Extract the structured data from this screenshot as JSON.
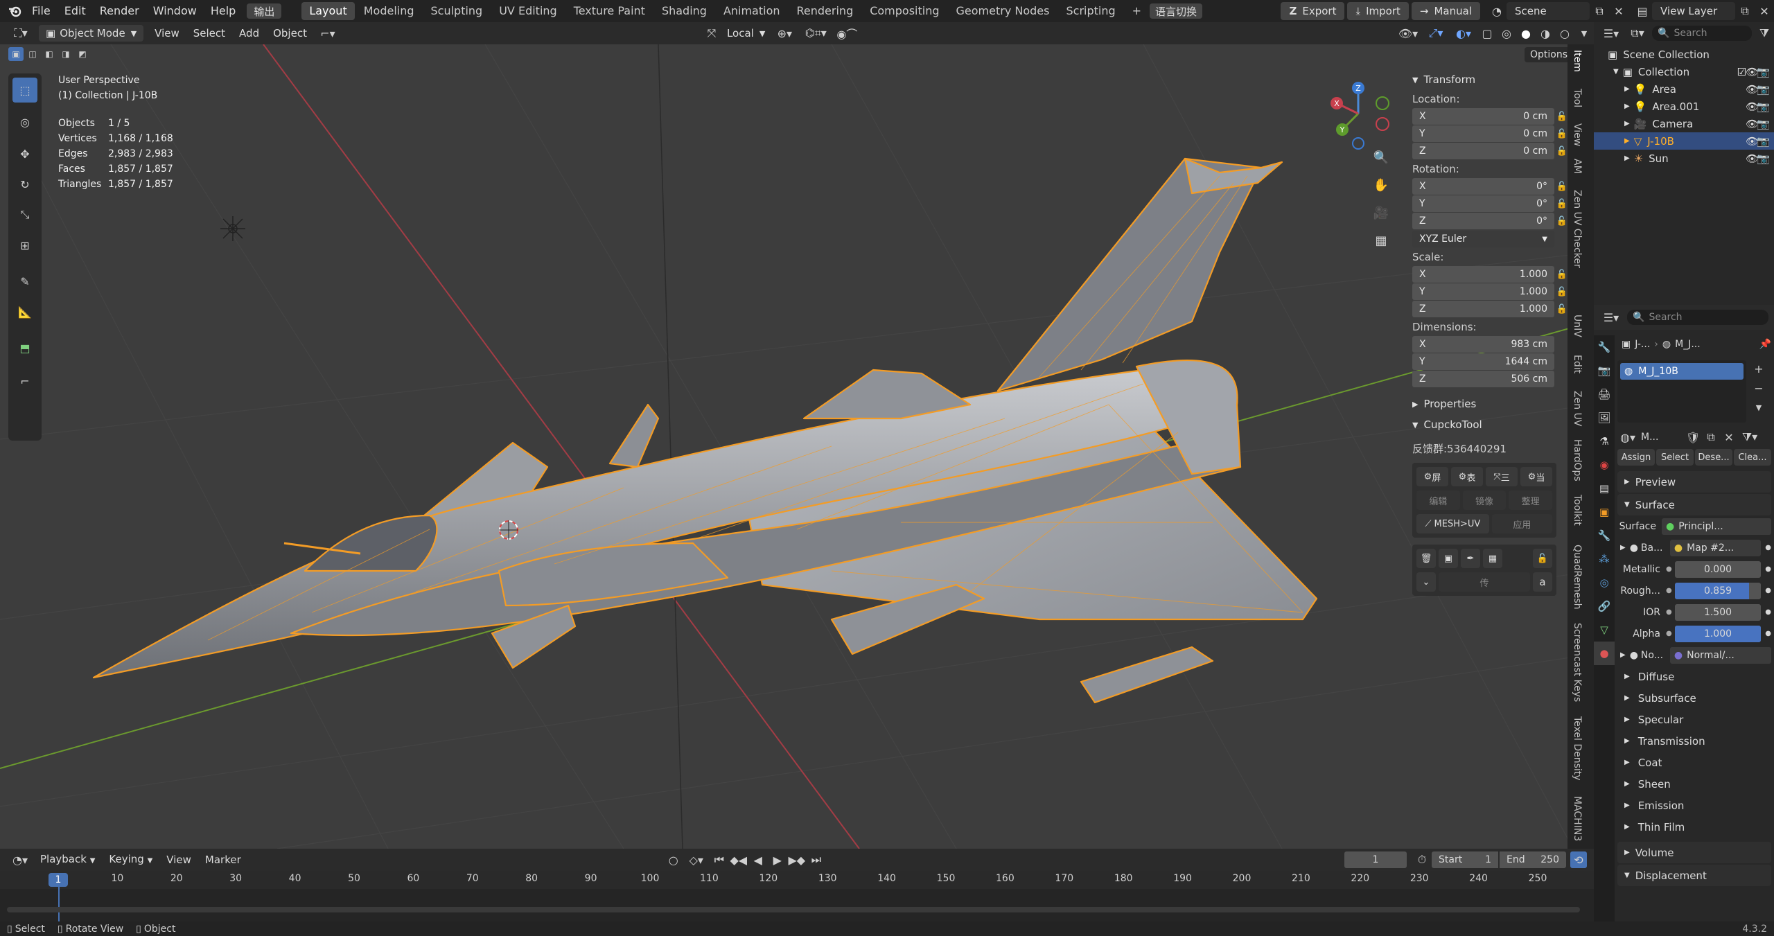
{
  "topbar": {
    "menus": [
      "File",
      "Edit",
      "Render",
      "Window",
      "Help"
    ],
    "output_button": "输出",
    "workspaces": [
      "Layout",
      "Modeling",
      "Sculpting",
      "UV Editing",
      "Texture Paint",
      "Shading",
      "Animation",
      "Rendering",
      "Compositing",
      "Geometry Nodes",
      "Scripting"
    ],
    "active_workspace": "Layout",
    "add_tab": "+",
    "lang_switch": "语言切换",
    "export_label": "Export",
    "import_label": "Import",
    "manual_label": "Manual",
    "scene_label": "Scene",
    "view_layer_label": "View Layer"
  },
  "viewport_header": {
    "mode": "Object Mode",
    "menus": [
      "View",
      "Select",
      "Add",
      "Object"
    ],
    "orientation": "Local",
    "options_label": "Options"
  },
  "viewport": {
    "perspective": "User Perspective",
    "collection_path": "(1) Collection | J-10B",
    "stats": [
      {
        "label": "Objects",
        "value": "1 / 5"
      },
      {
        "label": "Vertices",
        "value": "1,168 / 1,168"
      },
      {
        "label": "Edges",
        "value": "2,983 / 2,983"
      },
      {
        "label": "Faces",
        "value": "1,857 / 1,857"
      },
      {
        "label": "Triangles",
        "value": "1,857 / 1,857"
      }
    ],
    "gizmo_axes": [
      "X",
      "Y",
      "Z"
    ]
  },
  "npanel": {
    "transform_title": "Transform",
    "location_label": "Location:",
    "location": [
      {
        "axis": "X",
        "value": "0 cm"
      },
      {
        "axis": "Y",
        "value": "0 cm"
      },
      {
        "axis": "Z",
        "value": "0 cm"
      }
    ],
    "rotation_label": "Rotation:",
    "rotation": [
      {
        "axis": "X",
        "value": "0°"
      },
      {
        "axis": "Y",
        "value": "0°"
      },
      {
        "axis": "Z",
        "value": "0°"
      }
    ],
    "rotation_mode": "XYZ Euler",
    "scale_label": "Scale:",
    "scale": [
      {
        "axis": "X",
        "value": "1.000"
      },
      {
        "axis": "Y",
        "value": "1.000"
      },
      {
        "axis": "Z",
        "value": "1.000"
      }
    ],
    "dimensions_label": "Dimensions:",
    "dimensions": [
      {
        "axis": "X",
        "value": "983 cm"
      },
      {
        "axis": "Y",
        "value": "1644 cm"
      },
      {
        "axis": "Z",
        "value": "506 cm"
      }
    ],
    "properties_title": "Properties",
    "cupcko_title": "CupckoTool",
    "feedback": "反馈群:536440291",
    "cupcko_row1": [
      "屏",
      "表",
      "三",
      "当"
    ],
    "cupcko_row2": [
      "编辑",
      "镜像",
      "整理"
    ],
    "mesh_uv": "MESH>UV",
    "apply": "应用",
    "pass_label": "传"
  },
  "sidetabs": [
    "Item",
    "Tool",
    "View",
    "AM",
    "Zen UV Checker",
    "UnIV",
    "Edit",
    "Zen UV",
    "HardOps",
    "Toolkit",
    "QuadRemesh",
    "Screencast Keys",
    "Texel Density",
    "MACHIN3"
  ],
  "outliner": {
    "search_placeholder": "Search",
    "scene_collection": "Scene Collection",
    "collection": "Collection",
    "items": [
      "Area",
      "Area.001",
      "Camera",
      "J-10B",
      "Sun"
    ],
    "selected_item": "J-10B"
  },
  "properties": {
    "search_placeholder": "Search",
    "breadcrumb_object": "J-...",
    "breadcrumb_material": "M_J...",
    "material_slot": "M_J_10B",
    "material_name": "M...",
    "assign": "Assign",
    "select": "Select",
    "deselect": "Dese...",
    "clear": "Clea...",
    "preview": "Preview",
    "surface_section": "Surface",
    "surface_label": "Surface",
    "surface_value": "Principl...",
    "base_label": "Ba...",
    "base_value": "Map #2...",
    "metallic_label": "Metallic",
    "metallic_value": "0.000",
    "metallic": 0.0,
    "roughness_label": "Rough...",
    "roughness_value": "0.859",
    "roughness": 0.859,
    "ior_label": "IOR",
    "ior_value": "1.500",
    "alpha_label": "Alpha",
    "alpha_value": "1.000",
    "alpha": 1.0,
    "normal_label": "No...",
    "normal_value": "Normal/...",
    "subsections": [
      "Diffuse",
      "Subsurface",
      "Specular",
      "Transmission",
      "Coat",
      "Sheen",
      "Emission",
      "Thin Film"
    ],
    "volume": "Volume",
    "displacement": "Displacement"
  },
  "timeline": {
    "playback": "Playback",
    "keying": "Keying",
    "view": "View",
    "marker": "Marker",
    "current_frame": "1",
    "start_label": "Start",
    "start_value": "1",
    "end_label": "End",
    "end_value": "250",
    "ticks": [
      "10",
      "20",
      "30",
      "40",
      "50",
      "60",
      "70",
      "80",
      "90",
      "100",
      "110",
      "120",
      "130",
      "140",
      "150",
      "160",
      "170",
      "180",
      "190",
      "200",
      "210",
      "220",
      "230",
      "240",
      "250"
    ]
  },
  "statusbar": {
    "select": "Select",
    "rotate_view": "Rotate View",
    "object": "Object",
    "version": "4.3.2"
  },
  "colors": {
    "accent_blue": "#4772b3",
    "selection_orange": "#f39c26",
    "active_field_blue": "#4873c0"
  }
}
